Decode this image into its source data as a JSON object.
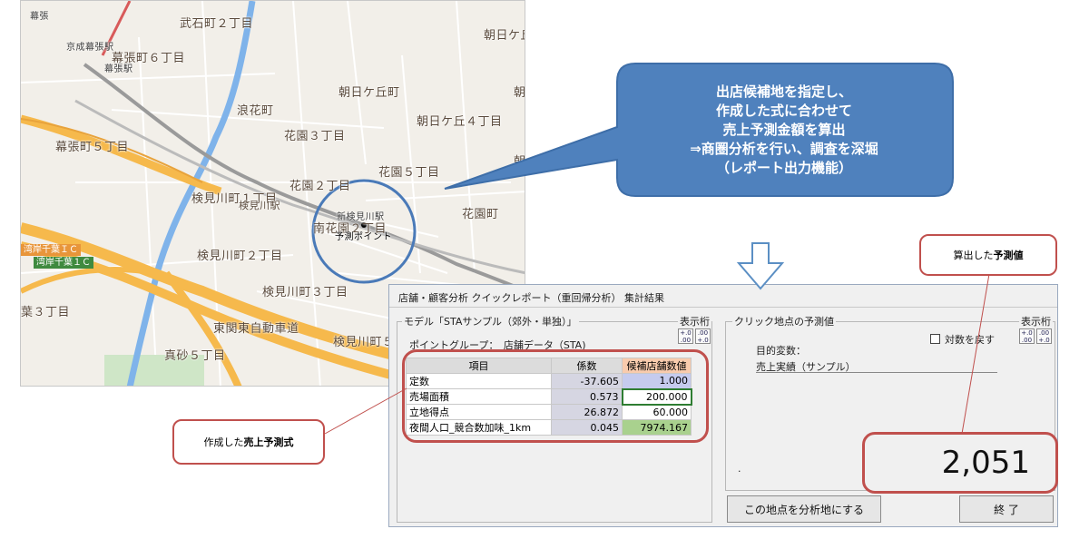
{
  "map": {
    "labels": [
      "武石町２丁目",
      "幕張",
      "京成幕張駅",
      "幕張町６丁目",
      "幕張駅",
      "朝日ケ丘",
      "朝日ケ丘町",
      "朝",
      "浪花町",
      "朝日ケ丘４丁目",
      "花園３丁目",
      "幕張町５丁目",
      "朝",
      "花園２丁目",
      "花園５丁目",
      "検見川町１丁目",
      "検見川駅",
      "新検見川駅",
      "南花園２丁目",
      "花園町",
      "予測ポイント",
      "湾岸千葉ＩＣ",
      "湾岸千葉１Ｃ",
      "検見川町２丁目",
      "検見川町３丁目",
      "葉３丁目",
      "東関東自動車道",
      "真砂５丁目",
      "検見川町５"
    ]
  },
  "callout": {
    "lines": [
      "出店候補地を指定し、",
      "作成した式に合わせて",
      "売上予測金額を算出",
      "⇒商圏分析を行い、調査を深堀",
      "（レポート出力機能）"
    ]
  },
  "label_predicted": {
    "prefix": "算出した",
    "bold": "予測値"
  },
  "label_formula": {
    "prefix": "作成した",
    "bold": "売上予測式"
  },
  "dialog": {
    "title": "店舗・顧客分析 クイックレポート（重回帰分析） 集計結果",
    "left_group": "モデル「STAサンプル（郊外・単独）」",
    "display_digits": "表示桁",
    "point_group": "ポイントグループ：　店舗データ（STA)",
    "digit_inc": "+.0 .00",
    "digit_dec": ".00 +.0",
    "table": {
      "headers": [
        "項目",
        "係数",
        "候補店舗数値"
      ],
      "rows": [
        {
          "item": "定数",
          "coef": "-37.605",
          "value": "1.000"
        },
        {
          "item": "売場面積",
          "coef": "0.573",
          "value": "200.000"
        },
        {
          "item": "立地得点",
          "coef": "26.872",
          "value": "60.000"
        },
        {
          "item": "夜間人口_競合数加味_1km",
          "coef": "0.045",
          "value": "7974.167"
        }
      ]
    },
    "right_group": "クリック地点の予測値",
    "right_display_digits": "表示桁",
    "log_label": "対数を戻す",
    "target_label": "目的変数：",
    "target_value": "売上実績（サンプル）",
    "dot": ".",
    "prediction": "2,051",
    "analysis_button": "この地点を分析地にする",
    "close_button": "終 了"
  },
  "colors": {
    "callout": "#4f81bd",
    "highlight": "#c0504d",
    "road_orange": "#f6b94c",
    "rail": "#8c8c8c",
    "green_cell": "#a9d18e",
    "blue_cell": "#c5cbee",
    "orange_header": "#f8cbad"
  }
}
